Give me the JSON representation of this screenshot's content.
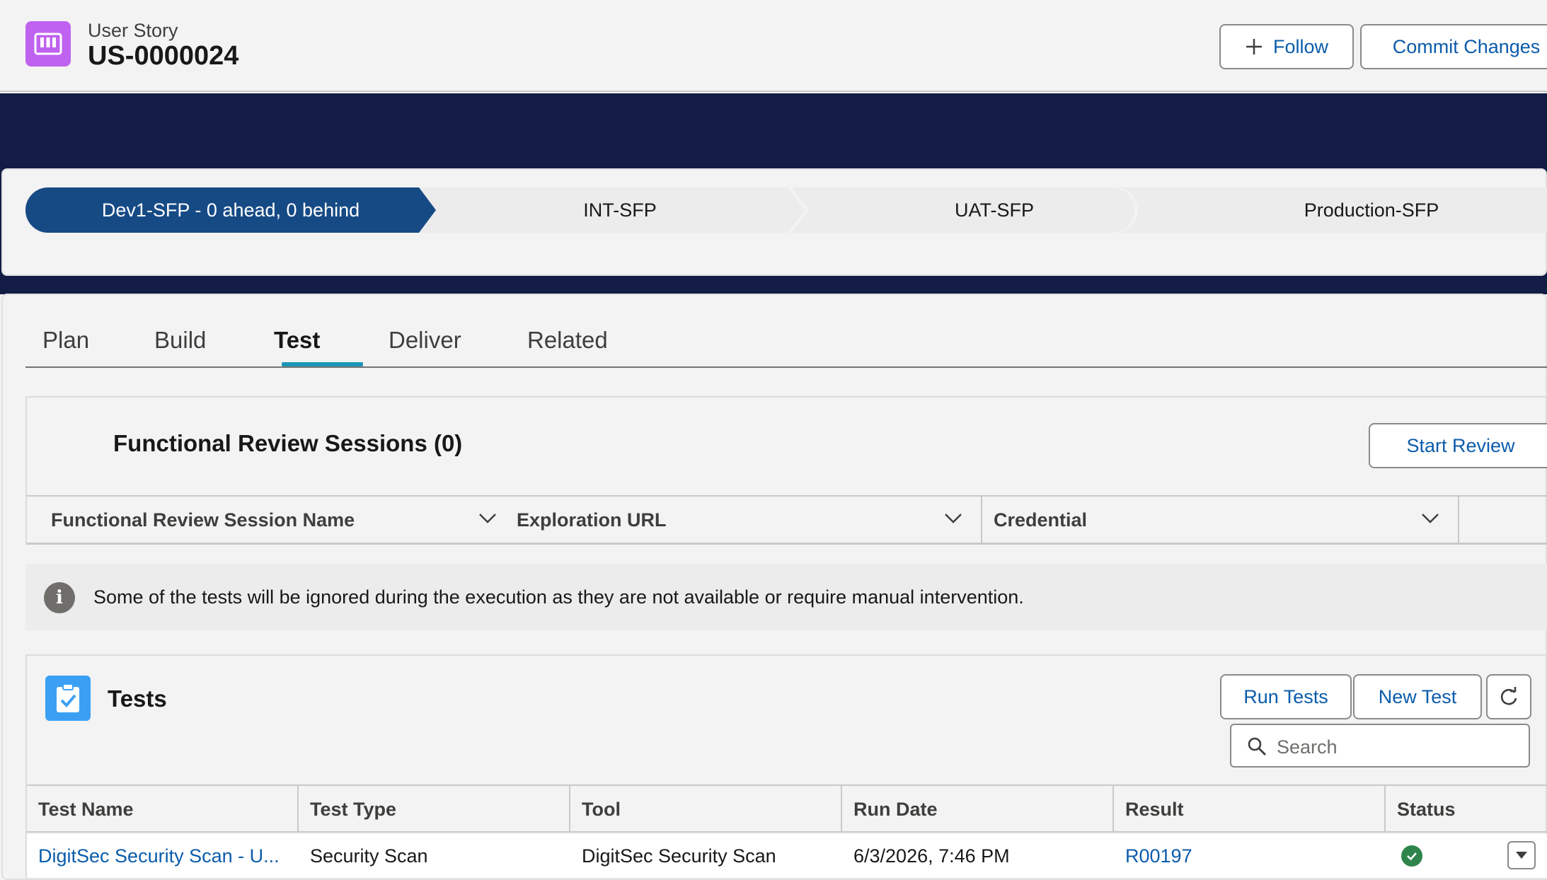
{
  "header": {
    "object_label": "User Story",
    "record_name": "US-0000024",
    "follow_label": "Follow",
    "commit_label": "Commit Changes",
    "icon": "user-story-icon"
  },
  "path": {
    "steps": [
      {
        "label": "Dev1-SFP - 0 ahead, 0 behind",
        "active": true
      },
      {
        "label": "INT-SFP",
        "active": false
      },
      {
        "label": "UAT-SFP",
        "active": false
      },
      {
        "label": "Production-SFP",
        "active": false
      }
    ],
    "active_color": "#164a85",
    "inactive_color": "#ececec"
  },
  "tabs": [
    {
      "label": "Plan",
      "active": false
    },
    {
      "label": "Build",
      "active": false
    },
    {
      "label": "Test",
      "active": true
    },
    {
      "label": "Deliver",
      "active": false
    },
    {
      "label": "Related",
      "active": false
    }
  ],
  "functional_review": {
    "title": "Functional Review Sessions (0)",
    "start_label": "Start Review",
    "columns": [
      "Functional Review Session Name",
      "Exploration URL",
      "Credential"
    ]
  },
  "info_banner": {
    "icon": "info-icon",
    "text": "Some of the tests will be ignored during the execution as they are not available or require manual intervention."
  },
  "tests": {
    "title": "Tests",
    "icon": "clipboard-check-icon",
    "run_label": "Run Tests",
    "new_label": "New Test",
    "search_placeholder": "Search",
    "columns": [
      "Test Name",
      "Test Type",
      "Tool",
      "Run Date",
      "Result",
      "Status"
    ],
    "rows": [
      {
        "test_name": "DigitSec Security Scan - U...",
        "test_type": "Security Scan",
        "tool": "DigitSec Security Scan",
        "run_date": "6/3/2026, 7:46 PM",
        "result": "R00197",
        "status": "success"
      }
    ]
  },
  "colors": {
    "brand_dark": "#121c45",
    "link": "#0b5cab",
    "tab_accent": "#1b96b6",
    "success": "#2e844a"
  }
}
